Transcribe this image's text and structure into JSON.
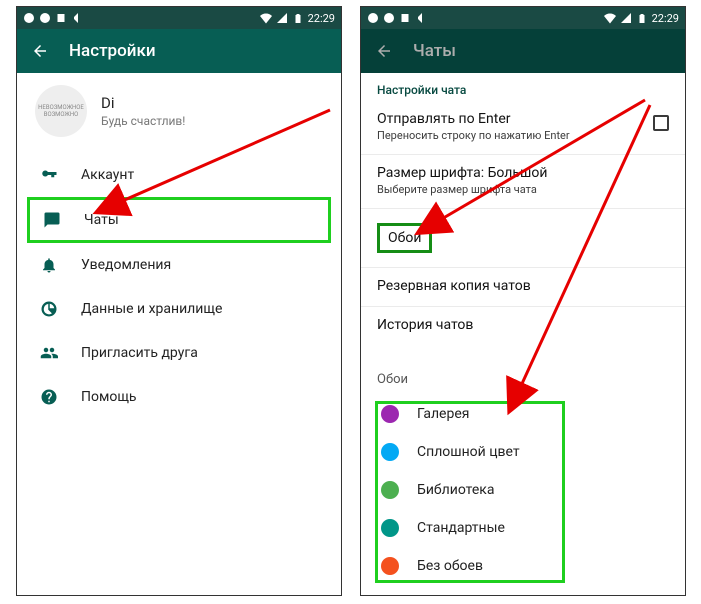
{
  "statusbar": {
    "time": "22:29"
  },
  "left": {
    "title": "Настройки",
    "profile": {
      "name": "Di",
      "status": "Будь счастлив!",
      "avatar_text": "НЕВОЗМОЖНОЕ\nВОЗМОЖНО"
    },
    "items": [
      {
        "icon": "key-icon",
        "label": "Аккаунт"
      },
      {
        "icon": "chat-icon",
        "label": "Чаты"
      },
      {
        "icon": "bell-icon",
        "label": "Уведомления"
      },
      {
        "icon": "data-icon",
        "label": "Данные и хранилище"
      },
      {
        "icon": "invite-icon",
        "label": "Пригласить друга"
      },
      {
        "icon": "help-icon",
        "label": "Помощь"
      }
    ]
  },
  "right": {
    "title": "Чаты",
    "section_header": "Настройки чата",
    "rows": [
      {
        "primary": "Отправлять по Enter",
        "secondary": "Переносить строку по нажатию Enter",
        "checkbox": true
      },
      {
        "primary": "Размер шрифта: Большой",
        "secondary": "Выберите размер шрифта чата"
      },
      {
        "primary": "Обои"
      },
      {
        "primary": "Резервная копия чатов"
      },
      {
        "primary": "История чатов"
      }
    ],
    "sheet": {
      "title": "Обои",
      "items": [
        {
          "color": "purple",
          "label": "Галерея"
        },
        {
          "color": "blue",
          "label": "Сплошной цвет"
        },
        {
          "color": "green",
          "label": "Библиотека"
        },
        {
          "color": "teal",
          "label": "Стандартные"
        },
        {
          "color": "red",
          "label": "Без обоев"
        }
      ]
    }
  }
}
